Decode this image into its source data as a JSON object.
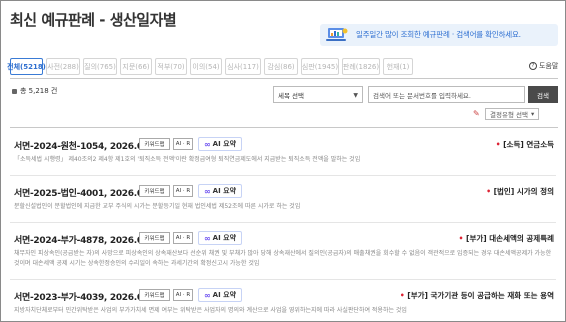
{
  "header": {
    "title": "최신 예규판례 - 생산일자별",
    "banner_text": "일주일간 많이 조회한 예규판례 · 검색어를 확인하세요."
  },
  "tabs": [
    {
      "label": "전체(5218)",
      "active": true
    },
    {
      "label": "사전(288)",
      "active": false
    },
    {
      "label": "질의(765)",
      "active": false
    },
    {
      "label": "지문(66)",
      "active": false
    },
    {
      "label": "적부(70)",
      "active": false
    },
    {
      "label": "이의(54)",
      "active": false
    },
    {
      "label": "심사(117)",
      "active": false
    },
    {
      "label": "감심(86)",
      "active": false
    },
    {
      "label": "심판(1945)",
      "active": false
    },
    {
      "label": "판례(1826)",
      "active": false
    },
    {
      "label": "헌재(1)",
      "active": false
    }
  ],
  "help_label": "도움말",
  "count_label": "총 5,218 건",
  "search": {
    "select_value": "세목 선택",
    "placeholder": "검색어 또는 문서번호를 입력하세요.",
    "button_label": "검색"
  },
  "sort_label": "결정유형 선택",
  "badges": {
    "keyword": "키워드맵",
    "ai": "AI · R"
  },
  "ai_summary_label": "AI 요약",
  "items": [
    {
      "title": "서면-2024-원천-1054, 2026.01.09",
      "category": "[소득] 연금소득",
      "snippet": "「소득세법 시행령」 제40조의2 제4항 제1호의 '퇴직소득 전액'이란 확정급여형 퇴직연금제도에서 지급받는 퇴직소득 전액을 말하는 것임"
    },
    {
      "title": "서면-2025-법인-4001, 2026.01.08",
      "category": "[법인] 시가의 정의",
      "snippet": "분할신설법인이 분할법인에 지급한 교부 주식의 시가는 분할등기일 현재 법인세법 제52조에 따른 시가로 하는 것임"
    },
    {
      "title": "서면-2024-부가-4878, 2026.01.08",
      "category": "[부가] 대손세액의 공제특례",
      "snippet": "채무자인 피상속인(공급받는 자)의 사망으로 피상속인의 상속재산보다 선순위 채권 및 부채가 많아 당해 상속재산에서 질의인(공급자)의 매출채권을 회수할 수 없음이 객관적으로 입증되는 경우 대손세액공제가 가능한 것이며 대손세액 공제 시기는 상속한정승인의 수리일이 속하는 과세기간의 확정신고시 가능한 것임"
    },
    {
      "title": "서면-2023-부가-4039, 2026.01.08",
      "category": "[부가] 국가기관 등이 공급하는 재화 또는 용역",
      "snippet": "지방자치단체로부터 민간위탁받은 사업의 부가가치세 면제 여부는 위탁받은 사업자의 명의와 계산으로 사업을 영위하는지에 따라 사실판단하여 적용하는 것임"
    }
  ]
}
